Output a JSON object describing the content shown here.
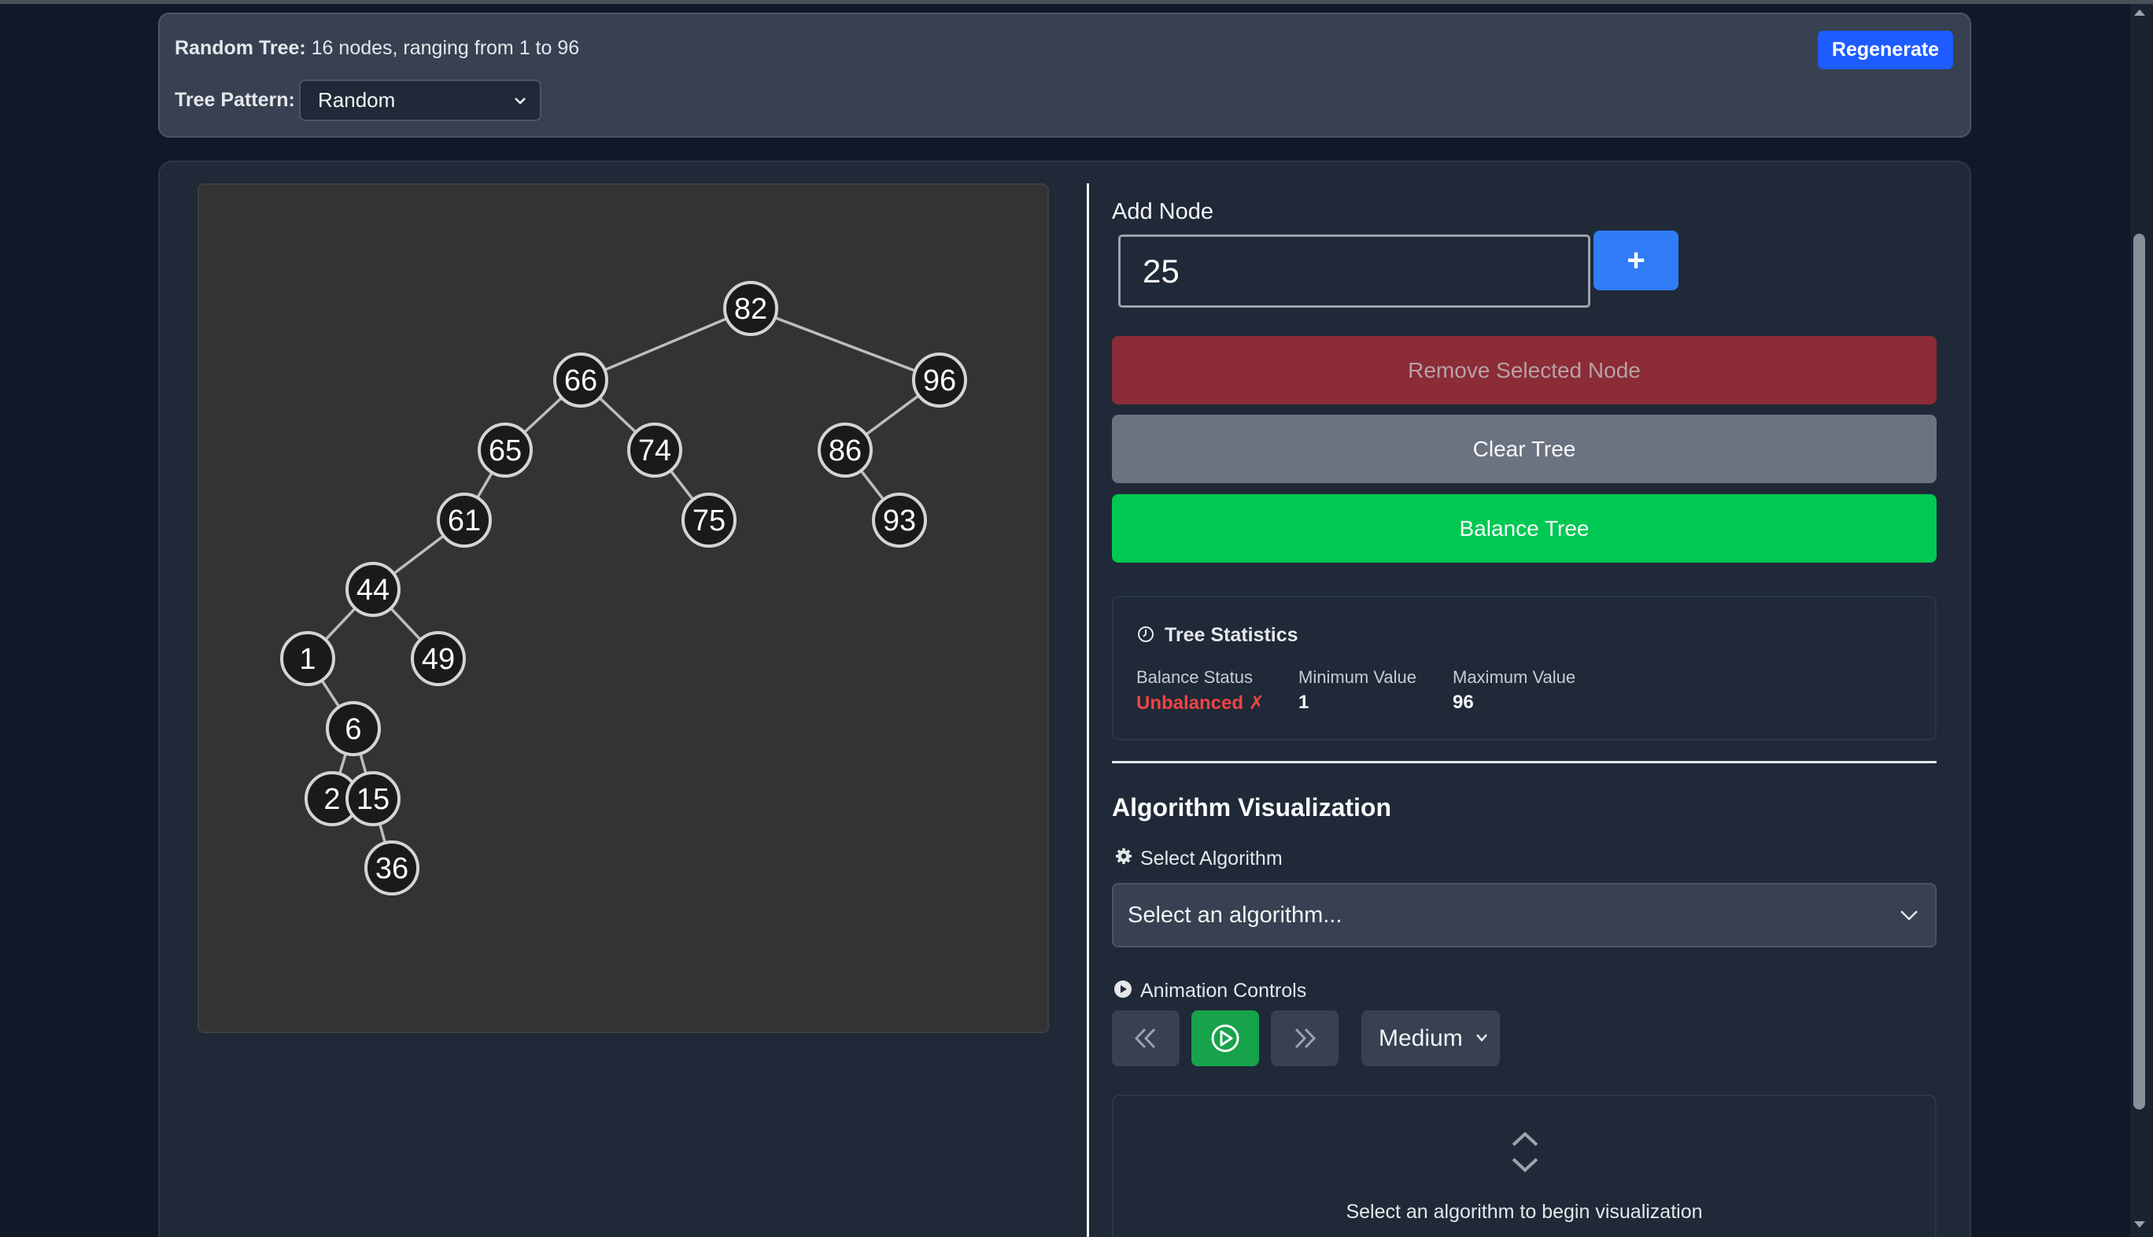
{
  "header": {
    "random_tree_label": "Random Tree:",
    "random_tree_desc": "16 nodes, ranging from 1 to 96",
    "pattern_label": "Tree Pattern:",
    "pattern_value": "Random",
    "regenerate_label": "Regenerate"
  },
  "tree": {
    "nodes": [
      "82",
      "66",
      "96",
      "65",
      "74",
      "86",
      "61",
      "75",
      "93",
      "44",
      "1",
      "49",
      "6",
      "2",
      "15",
      "36"
    ]
  },
  "add_node": {
    "label": "Add Node",
    "value": "25",
    "add_button": "+"
  },
  "actions": {
    "remove": "Remove Selected Node",
    "clear": "Clear Tree",
    "balance": "Balance Tree"
  },
  "stats": {
    "title": "Tree Statistics",
    "balance_label": "Balance Status",
    "balance_value": "Unbalanced ✗",
    "min_label": "Minimum Value",
    "min_value": "1",
    "max_label": "Maximum Value",
    "max_value": "96"
  },
  "algorithm": {
    "title": "Algorithm Visualization",
    "select_label": "Select Algorithm",
    "select_placeholder": "Select an algorithm...",
    "anim_label": "Animation Controls",
    "speed_value": "Medium",
    "empty_message": "Select an algorithm to begin visualization"
  },
  "colors": {
    "regenerate": "#1d5cff",
    "add": "#2f7cf6",
    "remove": "#8b2c36",
    "clear": "#6b7280",
    "balance": "#00c853",
    "play": "#16a34a",
    "unbalanced": "#ef4444"
  }
}
